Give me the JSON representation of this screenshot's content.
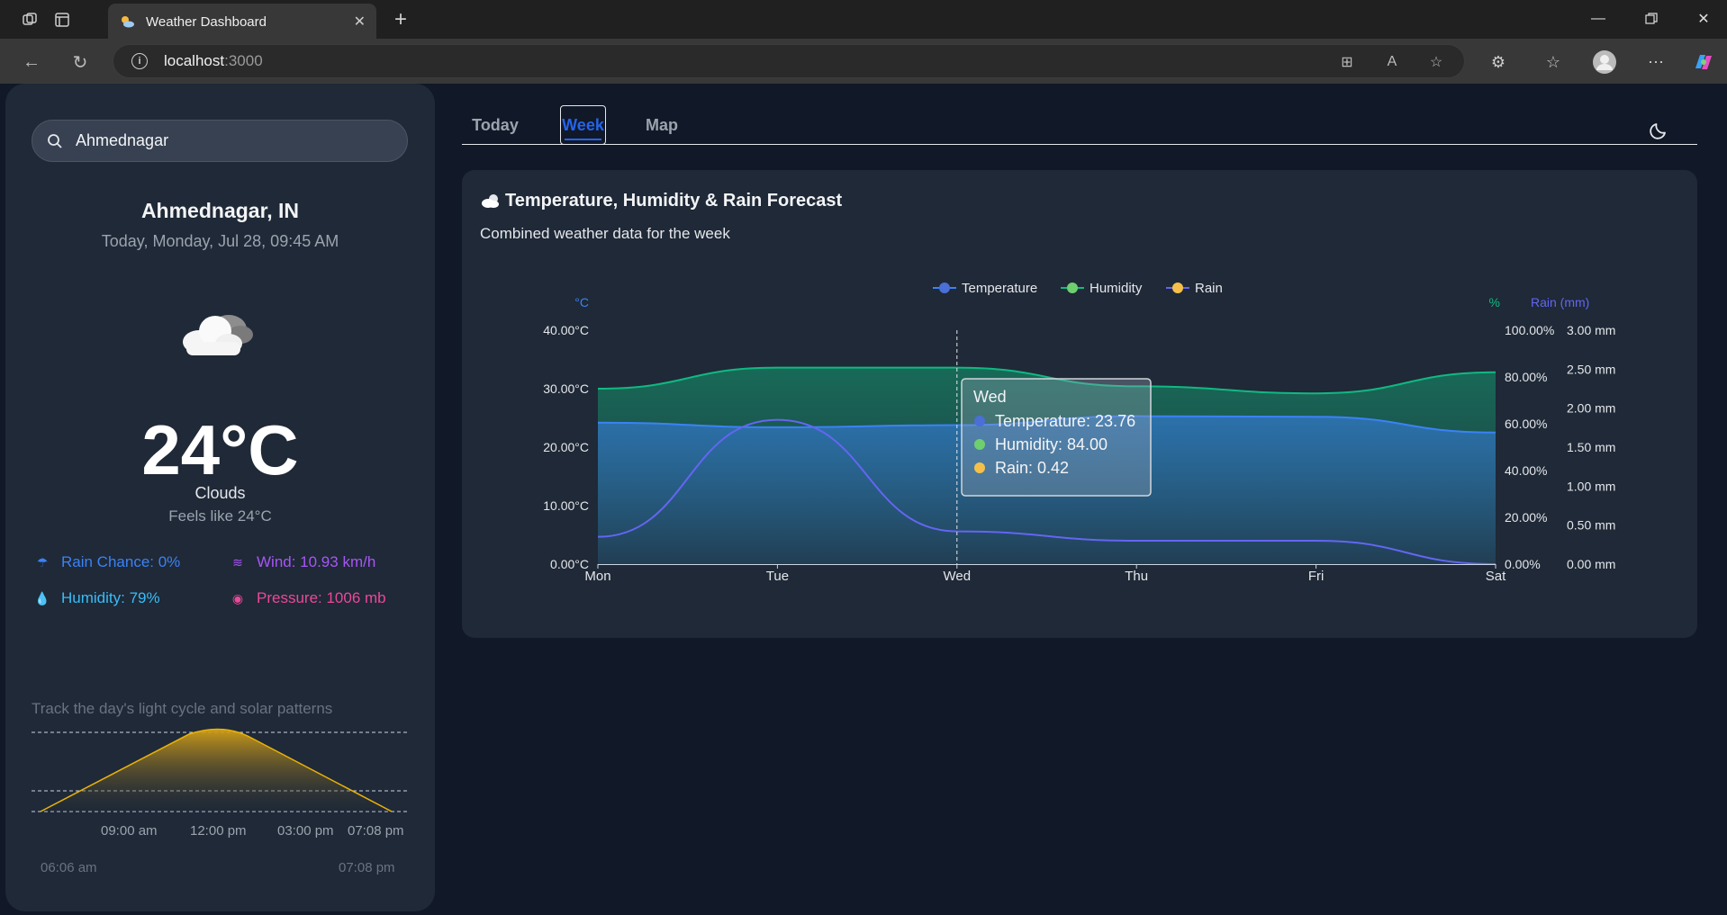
{
  "browser": {
    "tab_title": "Weather Dashboard",
    "url_host": "localhost",
    "url_port": ":3000"
  },
  "sidebar": {
    "search_value": "Ahmednagar",
    "city": "Ahmednagar, IN",
    "date": "Today, Monday, Jul 28, 09:45 AM",
    "icon": "cloud-icon",
    "temperature": "24°C",
    "condition": "Clouds",
    "feels_like": "Feels like 24°C",
    "stats": {
      "rain": "Rain Chance: 0%",
      "wind": "Wind: 10.93 km/h",
      "humidity": "Humidity: 79%",
      "pressure": "Pressure: 1006 mb"
    },
    "sun": {
      "title": "Track the day's light cycle and solar patterns",
      "ticks": [
        "09:00 am",
        "12:00 pm",
        "03:00 pm",
        "07:08 pm"
      ],
      "sunrise": "06:06 am",
      "sunset": "07:08 pm"
    }
  },
  "tabs": [
    "Today",
    "Week",
    "Map"
  ],
  "active_tab": "Week",
  "card": {
    "title": "Temperature, Humidity & Rain Forecast",
    "subtitle": "Combined weather data for the week"
  },
  "colors": {
    "temperature": "#3b82f6",
    "humidity": "#10b981",
    "rain": "#6366f1",
    "accent": "#2563eb",
    "wind": "#a855f7",
    "pressure": "#ec4899",
    "rain_stat": "#3b82f6",
    "humidity_stat": "#38bdf8"
  },
  "chart_data": {
    "type": "line",
    "categories": [
      "Mon",
      "Tue",
      "Wed",
      "Thu",
      "Fri",
      "Sat"
    ],
    "series": [
      {
        "name": "Temperature",
        "axis": "°C",
        "values": [
          24.2,
          23.4,
          23.76,
          25.3,
          25.2,
          22.5
        ],
        "color": "#3b82f6",
        "legend_dot": "#4a6fd6"
      },
      {
        "name": "Humidity",
        "axis": "%",
        "values": [
          75,
          84,
          84,
          76,
          73,
          82
        ],
        "color": "#10b981",
        "legend_dot": "#6fcf6f"
      },
      {
        "name": "Rain",
        "axis": "Rain (mm)",
        "values": [
          0.35,
          1.85,
          0.42,
          0.3,
          0.3,
          0.0
        ],
        "color": "#6366f1",
        "legend_dot": "#f5c04a"
      }
    ],
    "y_left": {
      "label": "°C",
      "ticks": [
        "40.00°C",
        "30.00°C",
        "20.00°C",
        "10.00°C",
        "0.00°C"
      ],
      "range": [
        0,
        40
      ]
    },
    "y_right1": {
      "label": "%",
      "ticks": [
        "100.00%",
        "80.00%",
        "60.00%",
        "40.00%",
        "20.00%",
        "0.00%"
      ],
      "range": [
        0,
        100
      ]
    },
    "y_right2": {
      "label": "Rain (mm)",
      "ticks": [
        "3.00 mm",
        "2.50 mm",
        "2.00 mm",
        "1.50 mm",
        "1.00 mm",
        "0.50 mm",
        "0.00 mm"
      ],
      "range": [
        0,
        3
      ]
    },
    "tooltip": {
      "title": "Wed",
      "lines": [
        "Temperature: 23.76",
        "Humidity: 84.00",
        "Rain: 0.42"
      ]
    },
    "legend_position": "top-center"
  }
}
